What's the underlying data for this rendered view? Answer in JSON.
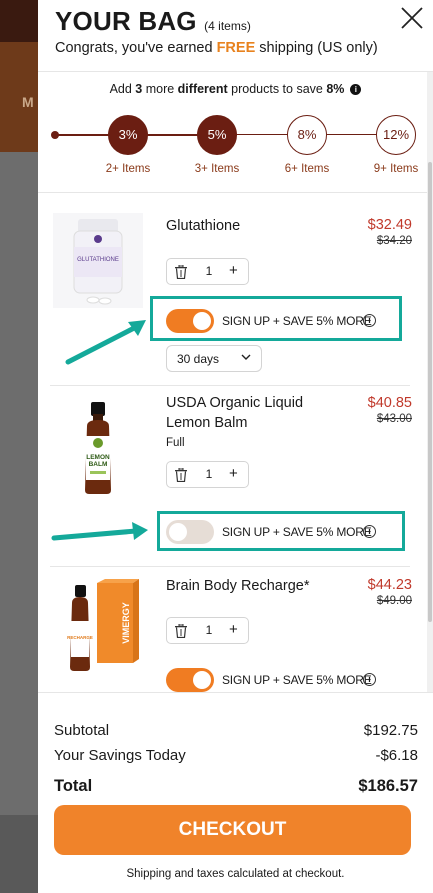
{
  "header": {
    "title": "YOUR BAG",
    "item_count": "(4 items)",
    "congrats_before": "Congrats, you've earned ",
    "congrats_free": "FREE",
    "congrats_after": " shipping (US only)"
  },
  "promo": {
    "p1": "Add ",
    "count": "3",
    "p2": " more ",
    "different": "different",
    "p3": " products to save ",
    "percent": "8%"
  },
  "tiers": [
    {
      "percent": "3%",
      "label": "2+ Items",
      "active": true
    },
    {
      "percent": "5%",
      "label": "3+ Items",
      "active": true
    },
    {
      "percent": "8%",
      "label": "6+ Items",
      "active": false
    },
    {
      "percent": "12%",
      "label": "9+ Items",
      "active": false
    }
  ],
  "background": {
    "letter": "M"
  },
  "items": [
    {
      "name_line1": "Glutathione",
      "name_line2": "",
      "variant": "",
      "price": "$32.49",
      "old_price": "$34.20",
      "qty": "1",
      "subscribe_label": "SIGN UP + SAVE 5% MORE",
      "subscribe_on": true,
      "frequency": "30 days",
      "bottle_label": "GLUTATHIONE"
    },
    {
      "name_line1": "USDA Organic Liquid",
      "name_line2": "Lemon Balm",
      "variant": "Full",
      "price": "$40.85",
      "old_price": "$43.00",
      "qty": "1",
      "subscribe_label": "SIGN UP + SAVE 5% MORE",
      "subscribe_on": false,
      "bottle_label1": "LEMON",
      "bottle_label2": "BALM"
    },
    {
      "name_line1": "Brain Body Recharge*",
      "name_line2": "",
      "variant": "",
      "price": "$44.23",
      "old_price": "$49.00",
      "qty": "1",
      "subscribe_label": "SIGN UP + SAVE 5% MORE",
      "subscribe_on": true,
      "box_label": "VIMERGY",
      "bottle_label": "RECHARGE"
    }
  ],
  "totals": {
    "subtotal_label": "Subtotal",
    "subtotal": "$192.75",
    "savings_label": "Your Savings Today",
    "savings": "-$6.18",
    "total_label": "Total",
    "total": "$186.57"
  },
  "checkout_label": "CHECKOUT",
  "shipping_note": "Shipping and taxes calculated at checkout.",
  "colors": {
    "accent_orange": "#f0832a",
    "tier_brown": "#6b1e12",
    "sale_red": "#c0392b",
    "highlight_teal": "#14a99a"
  }
}
